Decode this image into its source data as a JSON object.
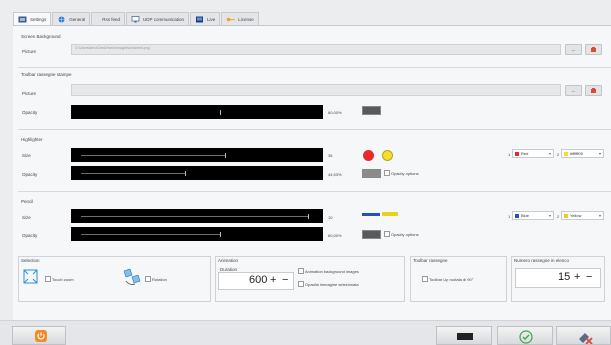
{
  "tabs": [
    {
      "label": "Settings",
      "icon": "settings-icon",
      "active": true
    },
    {
      "label": "General",
      "icon": "globe-icon"
    },
    {
      "label": "Rss feed",
      "icon": "rss-icon"
    },
    {
      "label": "UDP communication",
      "icon": "network-icon"
    },
    {
      "label": "Live",
      "icon": "live-icon"
    },
    {
      "label": "License",
      "icon": "key-icon"
    }
  ],
  "screen_background": {
    "title": "Screen Background",
    "picture_label": "Picture",
    "picture_path": "C:\\Users\\kero\\OneDrive\\Immagini\\unnamed.png",
    "browse_label": "..."
  },
  "toolbar_stampe": {
    "title": "Toolbar rassegne stampe",
    "picture_label": "Picture",
    "picture_path": "",
    "opacity_label": "Opacity",
    "opacity_value": "60,00%",
    "opacity_level": 0.6,
    "browse_label": "..."
  },
  "highlighter": {
    "title": "Highlighter",
    "size_label": "Size",
    "size_value": "35",
    "size_level": 0.62,
    "opacity_label": "Opacity",
    "opacity_value": "44,53%",
    "opacity_level": 0.45,
    "opacity_options_label": "Opacity options",
    "color1_index": "1",
    "color1_name": "Red",
    "color1_hex": "#e8292b",
    "color2_index": "2",
    "color2_name": "#ffffff00",
    "color2_hex": "#f2e02a"
  },
  "pencil": {
    "title": "Pencil",
    "size_label": "Size",
    "size_value": "10",
    "size_level": 0.98,
    "opacity_label": "Opacity",
    "opacity_value": "60,00%",
    "opacity_level": 0.6,
    "opacity_options_label": "Opacity options",
    "color1_index": "1",
    "color1_name": "Blue",
    "color1_hex": "#2c4fb5",
    "color2_index": "2",
    "color2_name": "Yellow",
    "color2_hex": "#e7d21b"
  },
  "selection": {
    "title": "Selection",
    "touch_zoom_label": "Touch zoom",
    "rotation_label": "Rotation"
  },
  "animation": {
    "title": "Animation",
    "duration_label": "Duration",
    "duration_value": "600",
    "plus": "+",
    "minus": "−",
    "anim_bg_label": "Animation background images",
    "opacity_sel_label": "Opacità immagine selezionata"
  },
  "toolbar_rassegne": {
    "title": "Toolbar rassegne",
    "ruotata_label": "Toolbar Up ruotata di 90°"
  },
  "numero_rassegne": {
    "title": "Numero rassegne in elenco",
    "value": "15",
    "plus": "+",
    "minus": "−"
  },
  "colors": {
    "accent_orange": "#f28c28",
    "check_green": "#3aa84a",
    "delete_red": "#e0473a"
  }
}
